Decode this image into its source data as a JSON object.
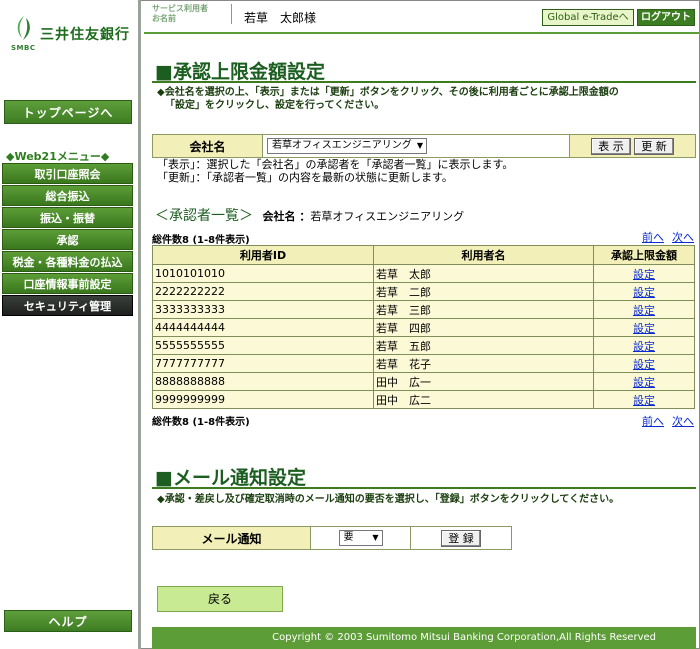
{
  "brand": {
    "smbc": "SMBC",
    "bank_name": "三井住友銀行"
  },
  "sidebar": {
    "top_page": "トップページへ",
    "menu_heading": "◆Web21メニュー◆",
    "items": [
      {
        "label": "取引口座照会",
        "style": "green"
      },
      {
        "label": "総合振込",
        "style": "green"
      },
      {
        "label": "振込・振替",
        "style": "green"
      },
      {
        "label": "承認",
        "style": "green"
      },
      {
        "label": "税金・各種料金の払込",
        "style": "green"
      },
      {
        "label": "口座情報事前設定",
        "style": "green"
      },
      {
        "label": "セキュリティ管理",
        "style": "dark"
      }
    ],
    "help": "ヘルプ"
  },
  "header": {
    "service_user_line1": "サービス利用者",
    "service_user_line2": "お名前",
    "user_name": "若草　太郎様",
    "global_btn": "Global e-Tradeへ",
    "logout_btn": "ログアウト"
  },
  "approval": {
    "title": "■承認上限金額設定",
    "instruction_line1": "◆会社名を選択の上、「表示」または「更新」ボタンをクリック、その後に利用者ごとに承認上限金額の",
    "instruction_line2": "「設定」をクリックし、設定を行ってください。",
    "company_label": "会社名",
    "company_value": "若草オフィスエンジニアリング",
    "show_btn": "表 示",
    "update_btn": "更 新",
    "note_line1": "「表示」：選択した「会社名」の承認者を「承認者一覧」に表示します。",
    "note_line2": "「更新」：「承認者一覧」の内容を最新の状態に更新します。"
  },
  "approver_list": {
    "heading": "＜承認者一覧＞",
    "company_prefix": "会社名 ：",
    "company_name": "若草オフィスエンジニアリング",
    "count_text": "総件数8 (1-8件表示)",
    "prev": "前へ",
    "next": "次へ",
    "columns": [
      "利用者ID",
      "利用者名",
      "承認上限金額"
    ],
    "rows": [
      {
        "id": "1010101010",
        "name": "若草　太郎",
        "action": "設定"
      },
      {
        "id": "2222222222",
        "name": "若草　二郎",
        "action": "設定"
      },
      {
        "id": "3333333333",
        "name": "若草　三郎",
        "action": "設定"
      },
      {
        "id": "4444444444",
        "name": "若草　四郎",
        "action": "設定"
      },
      {
        "id": "5555555555",
        "name": "若草　五郎",
        "action": "設定"
      },
      {
        "id": "7777777777",
        "name": "若草　花子",
        "action": "設定"
      },
      {
        "id": "8888888888",
        "name": "田中　広一",
        "action": "設定"
      },
      {
        "id": "9999999999",
        "name": "田中　広二",
        "action": "設定"
      }
    ]
  },
  "mail": {
    "title": "■メール通知設定",
    "instruction": "◆承認・差戻し及び確定取消時のメール通知の要否を選択し、「登録」ボタンをクリックしてください。",
    "label": "メール通知",
    "value": "要",
    "register_btn": "登 録"
  },
  "back_btn": "戻る",
  "footer": "Copyright © 2003 Sumitomo Mitsui Banking Corporation,All Rights Reserved"
}
